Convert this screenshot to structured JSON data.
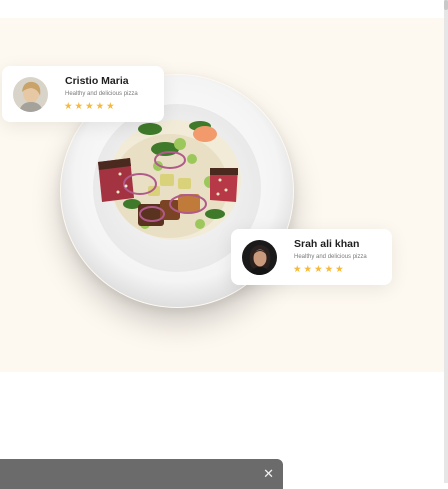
{
  "reviews": [
    {
      "name": "Cristio Maria",
      "subtitle": "Healthy and delicious pizza",
      "rating": 5,
      "avatar": "avatar-woman-light-background"
    },
    {
      "name": "Srah ali khan",
      "subtitle": "Healthy and delicious pizza",
      "rating": 5,
      "avatar": "avatar-woman-dark-background"
    }
  ],
  "hero": {
    "image": "salad-bowl-plate",
    "background_color": "#fdf8f0"
  },
  "toast": {
    "close_icon": "close-icon",
    "close_glyph": "✕",
    "background_color": "#6b6b6b"
  },
  "colors": {
    "star": "#f6b93b"
  }
}
